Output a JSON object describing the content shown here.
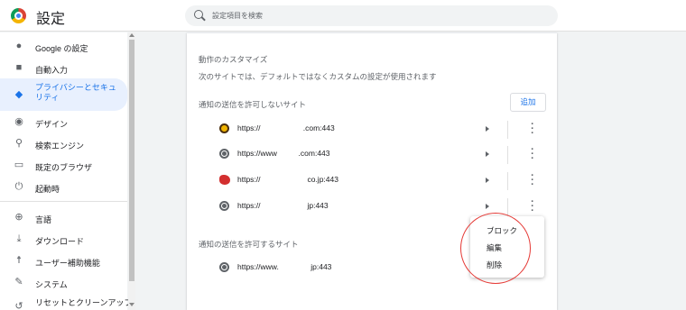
{
  "app": {
    "title": "設定"
  },
  "search": {
    "placeholder": "設定項目を検索"
  },
  "sidebar": {
    "items": [
      {
        "label": "Google の設定",
        "icon": "person-icon"
      },
      {
        "label": "自動入力",
        "icon": "clipboard-icon"
      },
      {
        "label": "プライバシーとセキュリティ",
        "icon": "shield-icon",
        "active": true
      },
      {
        "label": "デザイン",
        "icon": "palette-icon"
      },
      {
        "label": "検索エンジン",
        "icon": "search-icon"
      },
      {
        "label": "既定のブラウザ",
        "icon": "browser-icon"
      },
      {
        "label": "起動時",
        "icon": "power-icon"
      },
      {
        "label": "言語",
        "icon": "globe-icon"
      },
      {
        "label": "ダウンロード",
        "icon": "download-icon"
      },
      {
        "label": "ユーザー補助機能",
        "icon": "accessibility-icon"
      },
      {
        "label": "システム",
        "icon": "wrench-icon"
      },
      {
        "label": "リセットとクリーンアップ",
        "icon": "reset-icon"
      }
    ]
  },
  "main": {
    "custom_title": "動作のカスタマイズ",
    "custom_desc": "次のサイトでは、デフォルトではなくカスタムの設定が使用されます",
    "blocked_title": "通知の送信を許可しないサイト",
    "add_label": "追加",
    "blocked_sites": [
      {
        "url": "https://                    .com:443",
        "favicon": "yellow"
      },
      {
        "url": "https://www          .com:443",
        "favicon": "globe"
      },
      {
        "url": "https://                      co.jp:443",
        "favicon": "red"
      },
      {
        "url": "https://                      jp:443",
        "favicon": "globe"
      }
    ],
    "allowed_title": "通知の送信を許可するサイト",
    "allowed_sites": [
      {
        "url": "https://www.               jp:443",
        "favicon": "globe"
      }
    ]
  },
  "context_menu": {
    "items": [
      "ブロック",
      "編集",
      "削除"
    ]
  },
  "colors": {
    "accent": "#1a73e8",
    "annotation": "#e53935"
  }
}
